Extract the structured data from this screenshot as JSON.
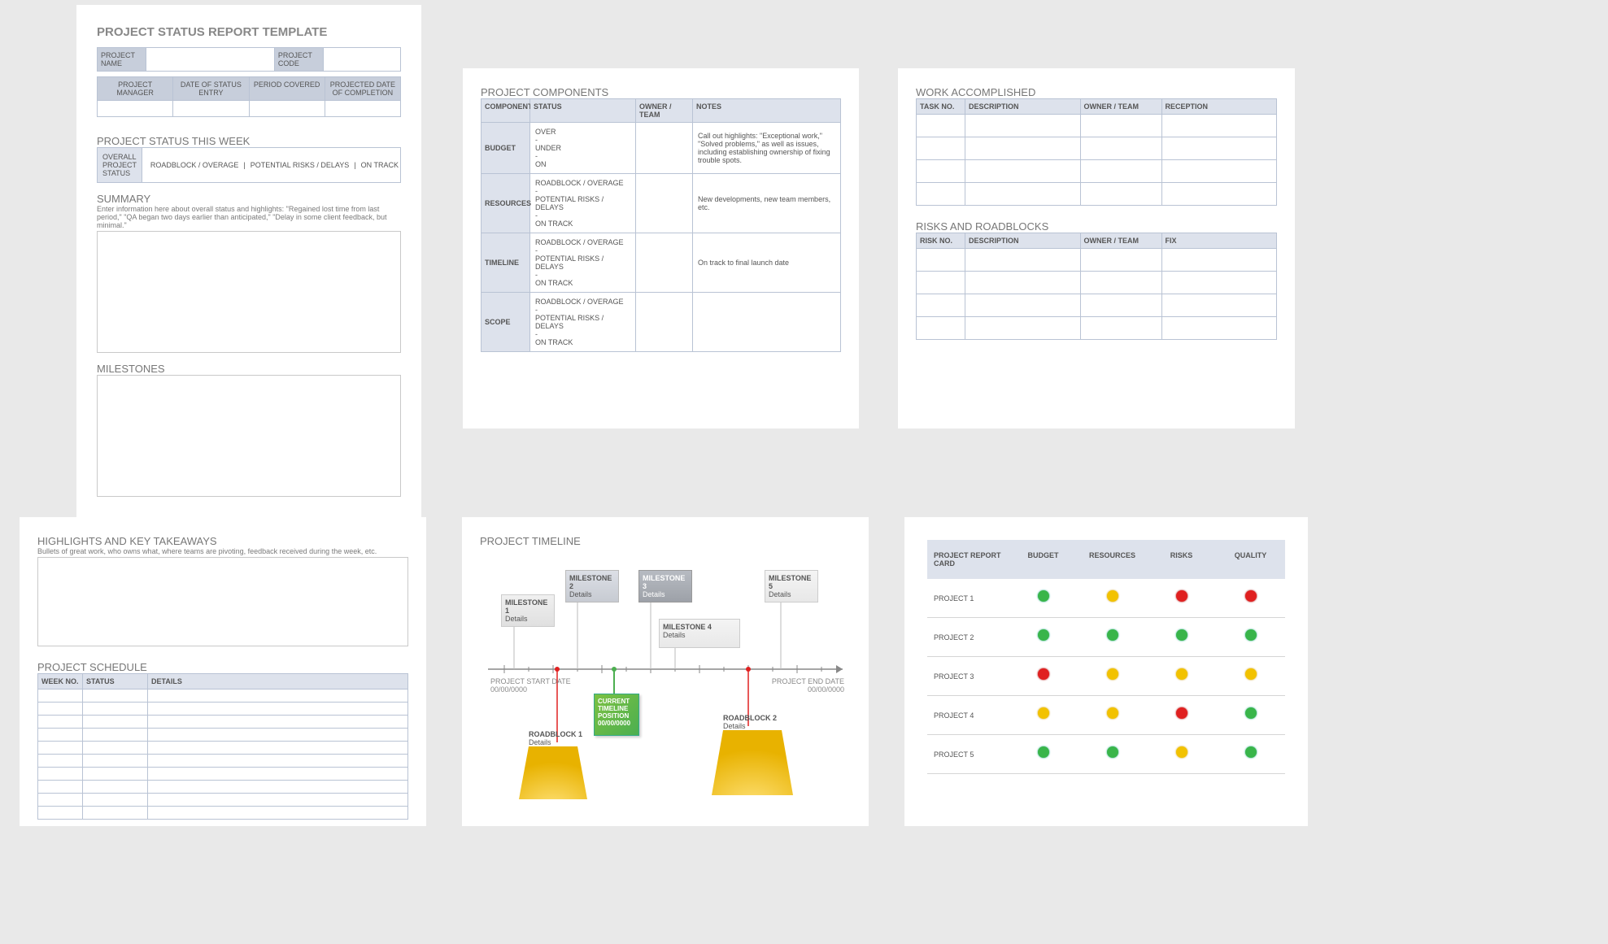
{
  "p1": {
    "title": "PROJECT STATUS REPORT TEMPLATE",
    "prj_name": "PROJECT NAME",
    "prj_code": "PROJECT CODE",
    "cols": [
      "PROJECT MANAGER",
      "DATE OF STATUS ENTRY",
      "PERIOD COVERED",
      "PROJECTED DATE OF COMPLETION"
    ],
    "status_week": "PROJECT STATUS THIS WEEK",
    "status_row": [
      "OVERALL PROJECT STATUS",
      "ROADBLOCK / OVERAGE",
      "|",
      "POTENTIAL RISKS / DELAYS",
      "|",
      "ON TRACK"
    ],
    "summary_h": "SUMMARY",
    "summary_sub": "Enter information here about overall status and highlights: \"Regained lost time from last period,\" \"QA began two days earlier than anticipated,\" \"Delay in some client feedback, but minimal.\"",
    "milestones_h": "MILESTONES"
  },
  "p2": {
    "title": "PROJECT COMPONENTS",
    "head": [
      "COMPONENT",
      "STATUS",
      "OWNER / TEAM",
      "NOTES"
    ],
    "rows": [
      {
        "c": "BUDGET",
        "s": "OVER\n-\nUNDER\n-\nON",
        "n": "Call out highlights: \"Exceptional work,\" \"Solved problems,\" as well as issues, including establishing ownership of fixing trouble spots."
      },
      {
        "c": "RESOURCES",
        "s": "ROADBLOCK / OVERAGE\n-\nPOTENTIAL RISKS / DELAYS\n-\nON TRACK",
        "n": "New developments, new team members, etc."
      },
      {
        "c": "TIMELINE",
        "s": "ROADBLOCK / OVERAGE\n-\nPOTENTIAL RISKS / DELAYS\n-\nON TRACK",
        "n": "On track to final launch date"
      },
      {
        "c": "SCOPE",
        "s": "ROADBLOCK / OVERAGE\n-\nPOTENTIAL RISKS / DELAYS\n-\nON TRACK",
        "n": ""
      }
    ]
  },
  "p3": {
    "work_h": "WORK ACCOMPLISHED",
    "work_head": [
      "TASK NO.",
      "DESCRIPTION",
      "OWNER / TEAM",
      "RECEPTION"
    ],
    "risks_h": "RISKS AND ROADBLOCKS",
    "risks_head": [
      "RISK NO.",
      "DESCRIPTION",
      "OWNER / TEAM",
      "FIX"
    ]
  },
  "p4": {
    "high_h": "HIGHLIGHTS AND KEY TAKEAWAYS",
    "high_sub": "Bullets of great work, who owns what, where teams are pivoting, feedback received during the week, etc.",
    "sched_h": "PROJECT SCHEDULE",
    "sched_head": [
      "WEEK NO.",
      "STATUS",
      "DETAILS"
    ]
  },
  "p5": {
    "title": "PROJECT TIMELINE",
    "start_lbl": "PROJECT START DATE",
    "end_lbl": "PROJECT END DATE",
    "date_ph": "00/00/0000",
    "miles": [
      "MILESTONE 1",
      "MILESTONE 2",
      "MILESTONE 3",
      "MILESTONE 4",
      "MILESTONE 5"
    ],
    "details": "Details",
    "current": "CURRENT TIMELINE POSITION",
    "roadblocks": [
      "ROADBLOCK 1",
      "ROADBLOCK 2"
    ]
  },
  "p6": {
    "title": "PROJECT REPORT CARD",
    "head": [
      "BUDGET",
      "RESOURCES",
      "RISKS",
      "QUALITY"
    ],
    "rows": [
      {
        "n": "PROJECT 1",
        "c": [
          "green",
          "yellow",
          "red",
          "red"
        ]
      },
      {
        "n": "PROJECT 2",
        "c": [
          "green",
          "green",
          "green",
          "green"
        ]
      },
      {
        "n": "PROJECT 3",
        "c": [
          "red",
          "yellow",
          "yellow",
          "yellow"
        ]
      },
      {
        "n": "PROJECT 4",
        "c": [
          "yellow",
          "yellow",
          "red",
          "green"
        ]
      },
      {
        "n": "PROJECT 5",
        "c": [
          "green",
          "green",
          "yellow",
          "green"
        ]
      }
    ]
  }
}
